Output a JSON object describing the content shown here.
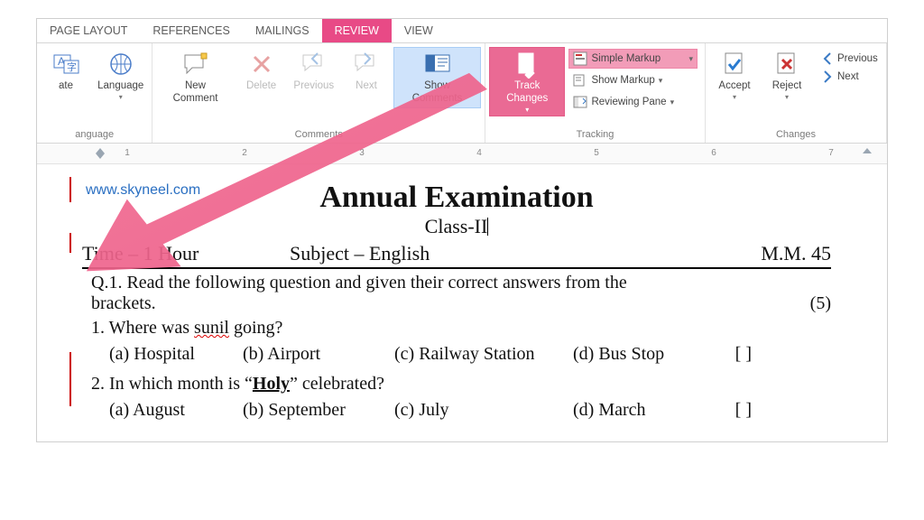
{
  "tabs": {
    "page_layout": "PAGE LAYOUT",
    "references": "REFERENCES",
    "mailings": "MAILINGS",
    "review": "REVIEW",
    "view": "VIEW"
  },
  "ribbon": {
    "language": {
      "translate": "ate",
      "language": "Language",
      "group_label": "anguage"
    },
    "comments": {
      "new_comment": "New Comment",
      "delete": "Delete",
      "previous": "Previous",
      "next": "Next",
      "show_comments": "Show Comments",
      "group_label": "Comments"
    },
    "tracking": {
      "track_changes": "Track Changes",
      "mode": "Simple Markup",
      "show_markup": "Show Markup",
      "reviewing_pane": "Reviewing Pane",
      "group_label": "Tracking"
    },
    "changes": {
      "accept": "Accept",
      "reject": "Reject",
      "previous": "Previous",
      "next": "Next",
      "group_label": "Changes"
    }
  },
  "ruler_marks": [
    "1",
    "2",
    "3",
    "4",
    "5",
    "6",
    "7"
  ],
  "doc": {
    "watermark": "www.skyneel.com",
    "title": "Annual Examination",
    "class_line": "Class-II",
    "time": "Time – 1 Hour",
    "subject": "Subject – English",
    "mm": "M.M. 45",
    "q1_a": "Q.1. Read the following question and given their correct answers from the",
    "q1_b": "brackets.",
    "q1_marks": "(5)",
    "q1_1_pre": "1. Where was ",
    "q1_1_err": "sunil",
    "q1_1_post": " going?",
    "q1_1_a": "(a) Hospital",
    "q1_1_b": "(b) Airport",
    "q1_1_c": "(c) Railway Station",
    "q1_1_d": "(d) Bus Stop",
    "ansbox": "[   ]",
    "q1_2_pre": "2. In which month is ",
    "q1_2_quote_open": "“",
    "q1_2_word": "Holy",
    "q1_2_quote_close": "”",
    "q1_2_post": " celebrated?",
    "q1_2_a": "(a) August",
    "q1_2_b": "(b) September",
    "q1_2_c": "(c) July",
    "q1_2_d": "(d) March"
  }
}
